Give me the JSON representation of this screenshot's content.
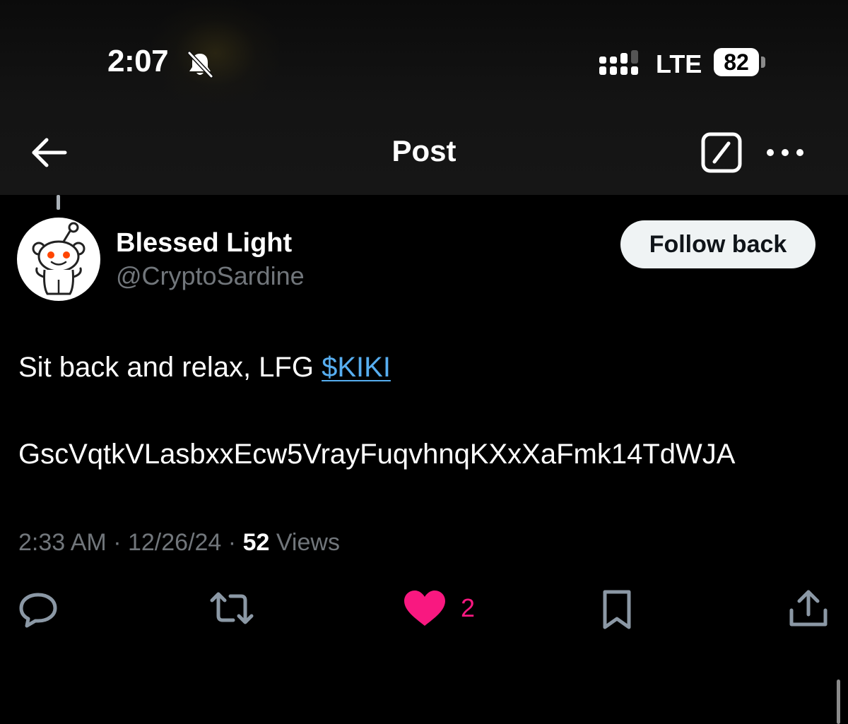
{
  "status_bar": {
    "time": "2:07",
    "network": "LTE",
    "battery": "82",
    "icons": [
      "bell-slash-icon",
      "signal-icon"
    ]
  },
  "nav": {
    "title": "Post",
    "icons": [
      "arrow-left-icon",
      "grok-icon",
      "more-icon"
    ]
  },
  "post": {
    "author": {
      "display_name": "Blessed Light",
      "handle": "@CryptoSardine",
      "avatar_icon": "reddit-snoo-icon"
    },
    "follow_label": "Follow back",
    "text": "Sit back and relax, LFG ",
    "cashtag": "$KIKI",
    "contract": "GscVqtkVLasbxxEcw5VrayFuqvhnqKXxXaFmk14TdWJA",
    "timestamp": "2:33 AM",
    "date": "12/26/24",
    "separator": "·",
    "views_count": "52",
    "views_label": "Views",
    "actions": {
      "like_count": "2",
      "icons": [
        "reply-icon",
        "repost-icon",
        "heart-icon",
        "bookmark-icon",
        "share-icon"
      ]
    }
  },
  "colors": {
    "background": "#000000",
    "topbar": "#161616",
    "link": "#57aef0",
    "like": "#f91880",
    "muted": "#71767b",
    "action_icon": "#8b98a5",
    "follow_button": "#eff3f4"
  }
}
